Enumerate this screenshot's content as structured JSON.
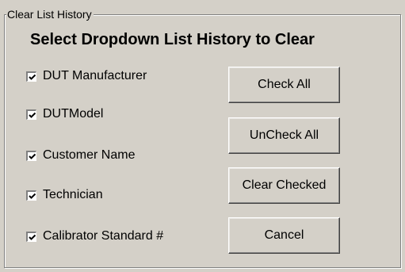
{
  "group": {
    "title": "Clear List History"
  },
  "heading": "Select Dropdown List History to Clear",
  "checkboxes": [
    {
      "label": "DUT Manufacturer",
      "checked": true
    },
    {
      "label": "DUTModel",
      "checked": true
    },
    {
      "label": "Customer Name",
      "checked": true
    },
    {
      "label": "Technician",
      "checked": true
    },
    {
      "label": "Calibrator Standard #",
      "checked": true
    }
  ],
  "buttons": {
    "check_all": "Check All",
    "uncheck_all": "UnCheck All",
    "clear_checked": "Clear Checked",
    "cancel": "Cancel"
  },
  "colors": {
    "face": "#d4d0c8",
    "shadow": "#808080",
    "highlight": "#ffffff",
    "dark_shadow": "#404040"
  }
}
